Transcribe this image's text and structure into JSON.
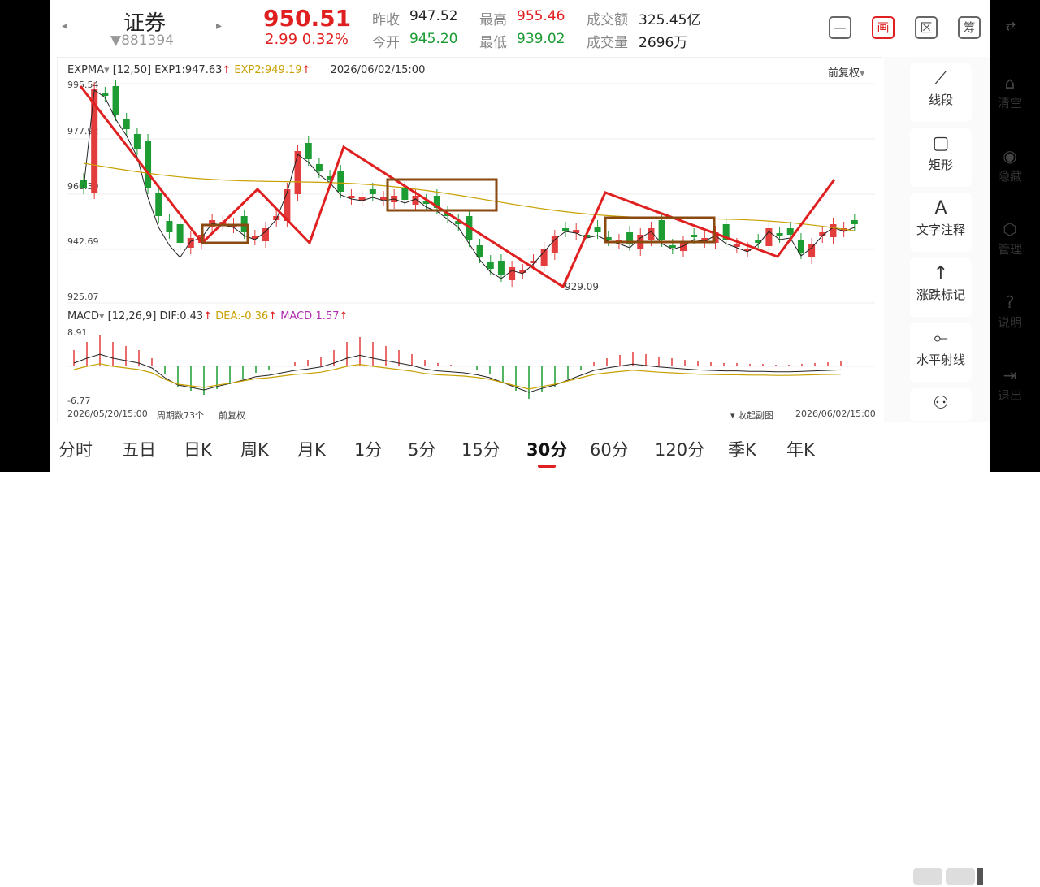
{
  "header": {
    "stock_name": "证券",
    "stock_code": "▼881394",
    "price": "950.51",
    "change": "2.99  0.32%",
    "prev_close_label": "昨收",
    "prev_close": "947.52",
    "open_label": "今开",
    "open": "945.20",
    "high_label": "最高",
    "high": "955.46",
    "low_label": "最低",
    "low": "939.02",
    "amount_label": "成交额",
    "amount": "325.45亿",
    "volume_label": "成交量",
    "volume": "2696万",
    "icons": [
      "minus-icon",
      "chart-icon",
      "region-icon",
      "chip-icon",
      "phone-rotate-icon"
    ],
    "icon_glyphs": [
      "—",
      "画",
      "区",
      "筹",
      "⇄"
    ]
  },
  "main_chart": {
    "indicator": "EXPMA",
    "params": "[12,50]",
    "exp1": "EXP1:947.63",
    "exp2": "EXP2:949.19",
    "datetime": "2026/06/02/15:00",
    "adjust": "前复权",
    "y_labels": [
      "995.54",
      "977.92",
      "960.30",
      "942.69",
      "925.07"
    ],
    "low_mark": "929.09"
  },
  "macd_chart": {
    "indicator": "MACD",
    "params": "[12,26,9]",
    "dif": "DIF:0.43",
    "dea": "DEA:-0.36",
    "macd": "MACD:1.57",
    "y_top": "8.91",
    "y_bottom": "-6.77",
    "start_time": "2026/05/20/15:00",
    "period_count": "周期数73个",
    "adjust": "前复权",
    "collapse": "收起副图",
    "end_time": "2026/06/02/15:00"
  },
  "chart_data": {
    "type": "candlestick",
    "ylim": [
      925.07,
      995.54
    ],
    "series": [
      {
        "name": "EXP1",
        "value": 947.63
      },
      {
        "name": "EXP2",
        "value": 949.19
      }
    ]
  },
  "tools": [
    {
      "icon": "segment-icon",
      "glyph": "⟋",
      "label": "线段"
    },
    {
      "icon": "rectangle-icon",
      "glyph": "▢",
      "label": "矩形"
    },
    {
      "icon": "text-note-icon",
      "glyph": "A",
      "label": "文字注释"
    },
    {
      "icon": "rise-fall-icon",
      "glyph": "↑",
      "label": "涨跌标记"
    },
    {
      "icon": "horizontal-ray-icon",
      "glyph": "⟜",
      "label": "水平射线"
    },
    {
      "icon": "more-tools-icon",
      "glyph": "⚇",
      "label": ""
    }
  ],
  "side": [
    {
      "icon": "clear-icon",
      "glyph": "⌂",
      "label": "清空"
    },
    {
      "icon": "hide-icon",
      "glyph": "◉",
      "label": "隐藏"
    },
    {
      "icon": "manage-icon",
      "glyph": "⬡",
      "label": "管理"
    },
    {
      "icon": "help-icon",
      "glyph": "?",
      "label": "说明"
    },
    {
      "icon": "exit-icon",
      "glyph": "⇥",
      "label": "退出"
    }
  ],
  "tabs": [
    "分时",
    "五日",
    "日K",
    "周K",
    "月K",
    "1分",
    "5分",
    "15分",
    "30分",
    "60分",
    "120分",
    "季K",
    "年K"
  ],
  "active_tab": "30分"
}
